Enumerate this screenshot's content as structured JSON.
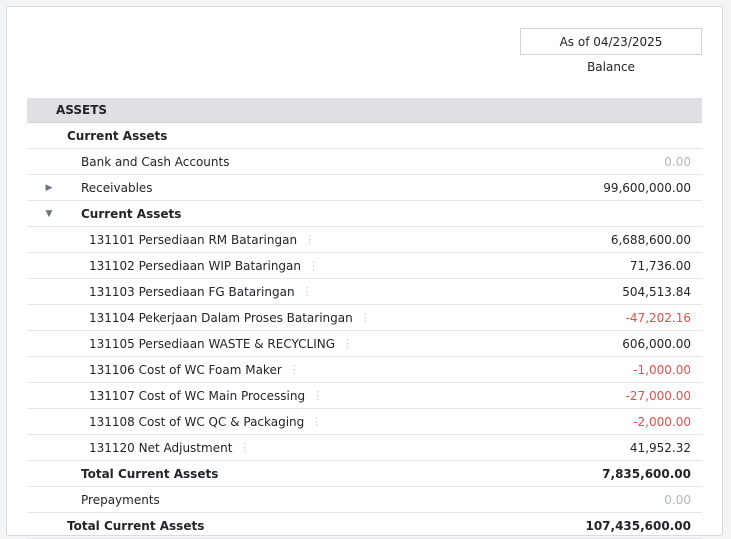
{
  "header": {
    "date_label": "As of 04/23/2025",
    "column_title": "Balance"
  },
  "report": {
    "section": "ASSETS",
    "current_assets_group": "Current Assets",
    "rows": {
      "bank": {
        "label": "Bank and Cash Accounts",
        "value": "0.00"
      },
      "receivables": {
        "label": "Receivables",
        "value": "99,600,000.00"
      },
      "current_assets": {
        "label": "Current Assets"
      },
      "acc_131101": {
        "label": "131101 Persediaan RM Bataringan",
        "value": "6,688,600.00"
      },
      "acc_131102": {
        "label": "131102 Persediaan WIP Bataringan",
        "value": "71,736.00"
      },
      "acc_131103": {
        "label": "131103 Persediaan FG Bataringan",
        "value": "504,513.84"
      },
      "acc_131104": {
        "label": "131104 Pekerjaan Dalam Proses Bataringan",
        "value": "-47,202.16"
      },
      "acc_131105": {
        "label": "131105 Persediaan WASTE & RECYCLING",
        "value": "606,000.00"
      },
      "acc_131106": {
        "label": "131106 Cost of WC Foam Maker",
        "value": "-1,000.00"
      },
      "acc_131107": {
        "label": "131107 Cost of WC Main Processing",
        "value": "-27,000.00"
      },
      "acc_131108": {
        "label": "131108 Cost of WC QC & Packaging",
        "value": "-2,000.00"
      },
      "acc_131120": {
        "label": "131120 Net Adjustment",
        "value": "41,952.32"
      },
      "total_current_inner": {
        "label": "Total Current Assets",
        "value": "7,835,600.00"
      },
      "prepayments": {
        "label": "Prepayments",
        "value": "0.00"
      },
      "total_current_outer": {
        "label": "Total Current Assets",
        "value": "107,435,600.00"
      }
    }
  },
  "icons": {
    "collapsed": "caret-right-icon",
    "expanded": "caret-down-icon",
    "row_menu": "kebab-menu-icon"
  },
  "colors": {
    "negative": "#d9534f",
    "muted": "#b4b8bd",
    "section_bg": "#dee0e3"
  }
}
